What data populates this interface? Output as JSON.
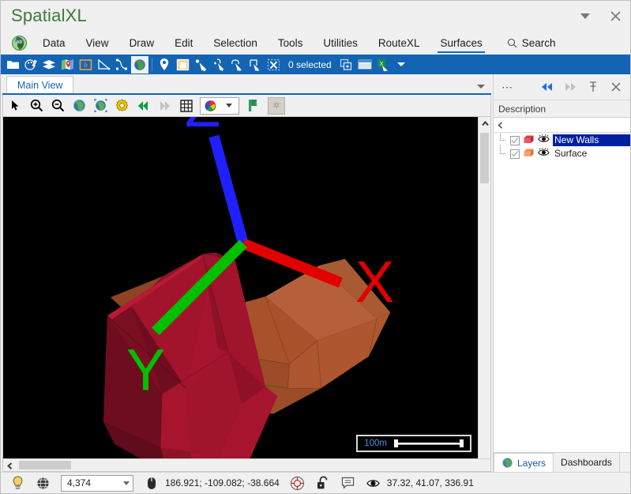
{
  "window": {
    "title": "SpatialXL",
    "dropdown_icon": "chevron-down-icon",
    "close_icon": "close-icon"
  },
  "menubar": {
    "logo_icon": "globe-africa-logo-icon",
    "items": [
      {
        "label": "Data",
        "active": false
      },
      {
        "label": "View",
        "active": false
      },
      {
        "label": "Draw",
        "active": false
      },
      {
        "label": "Edit",
        "active": false
      },
      {
        "label": "Selection",
        "active": false
      },
      {
        "label": "Tools",
        "active": false
      },
      {
        "label": "Utilities",
        "active": false
      },
      {
        "label": "RouteXL",
        "active": false
      },
      {
        "label": "Surfaces",
        "active": true
      }
    ],
    "search": {
      "label": "Search",
      "icon": "search-icon"
    }
  },
  "toolbar": {
    "selection_count": "0 selected",
    "icons": [
      "open-folder-icon",
      "palette-brush-icon",
      "layers-stack-icon",
      "map-pin-icon",
      "bounding-box-icon",
      "measure-angle-icon",
      "polyline-node-icon",
      "globe-icon",
      "location-pin-icon",
      "window-map-icon",
      "select-arrow-icon",
      "select-add-icon",
      "select-rect-icon",
      "select-lasso-icon",
      "select-crop-icon",
      "clear-selection-icon",
      "copy-selection-icon",
      "table-view-icon",
      "excel-export-icon",
      "overflow-caret-icon"
    ]
  },
  "document_tabs": {
    "tabs": [
      {
        "label": "Main View",
        "active": true
      }
    ],
    "overflow_icon": "chevron-down-icon"
  },
  "view_toolbar": {
    "icons": [
      "pointer-arrow-icon",
      "zoom-in-icon",
      "zoom-out-icon",
      "globe-blue-icon",
      "globe-extent-icon",
      "settings-gear-icon",
      "rewind-icon",
      "forward-icon",
      "grid-icon",
      "color-palette-icon",
      "palette-dropdown-caret-icon",
      "bookmark-flag-icon",
      "snapshot-icon"
    ]
  },
  "viewport": {
    "background_color": "#000000",
    "scalebar": {
      "label": "100m",
      "label_color": "#4a90e2"
    },
    "axis_indicator": {
      "axes": [
        {
          "name": "Z",
          "color": "#2020ff"
        },
        {
          "name": "X",
          "color": "#e00000"
        },
        {
          "name": "Y",
          "color": "#00c000"
        }
      ]
    },
    "model": {
      "walls_color": "#a6142e",
      "walls_color_dark": "#7a0f22",
      "walls_color_mid": "#8d1226",
      "surface_color": "#a8522c",
      "surface_color_light": "#b5603a",
      "surface_color_dark": "#8e4424"
    },
    "scrollbars": {
      "vertical_up_icon": "chevron-up-icon",
      "horizontal_left_icon": "chevron-left-icon"
    }
  },
  "right_panel": {
    "header": {
      "menu_icon": "ellipsis-icon",
      "back_icon": "double-arrow-left-icon",
      "forward_icon": "double-arrow-right-icon",
      "pin_icon": "pin-icon",
      "close_icon": "close-icon"
    },
    "column_header": "Description",
    "filter_icon": "chevron-left-icon",
    "layers": [
      {
        "name": "New Walls",
        "checked": true,
        "visible": true,
        "swatch_color": "#e8333f",
        "selected": true,
        "symbol_icon": "solid-block-icon",
        "eye_icon": "eye-icon"
      },
      {
        "name": "Surface",
        "checked": true,
        "visible": true,
        "swatch_color": "#ef8b5c",
        "selected": false,
        "symbol_icon": "solid-block-icon",
        "eye_icon": "eye-icon"
      }
    ],
    "tabs": [
      {
        "label": "Layers",
        "active": true,
        "icon": "globe-icon"
      },
      {
        "label": "Dashboards",
        "active": false,
        "icon": ""
      }
    ]
  },
  "statusbar": {
    "lightbulb_icon": "lightbulb-icon",
    "globe_icon": "globe-wire-icon",
    "scale_value": "4,374",
    "mouse_icon": "mouse-icon",
    "mouse_coords": "186.921; -109.082; -38.664",
    "target_icon": "target-icon",
    "lock_icon": "unlocked-padlock-icon",
    "note_icon": "note-icon",
    "eye_icon": "eye-icon",
    "camera_coords": "37.32, 41.07, 336.91"
  }
}
